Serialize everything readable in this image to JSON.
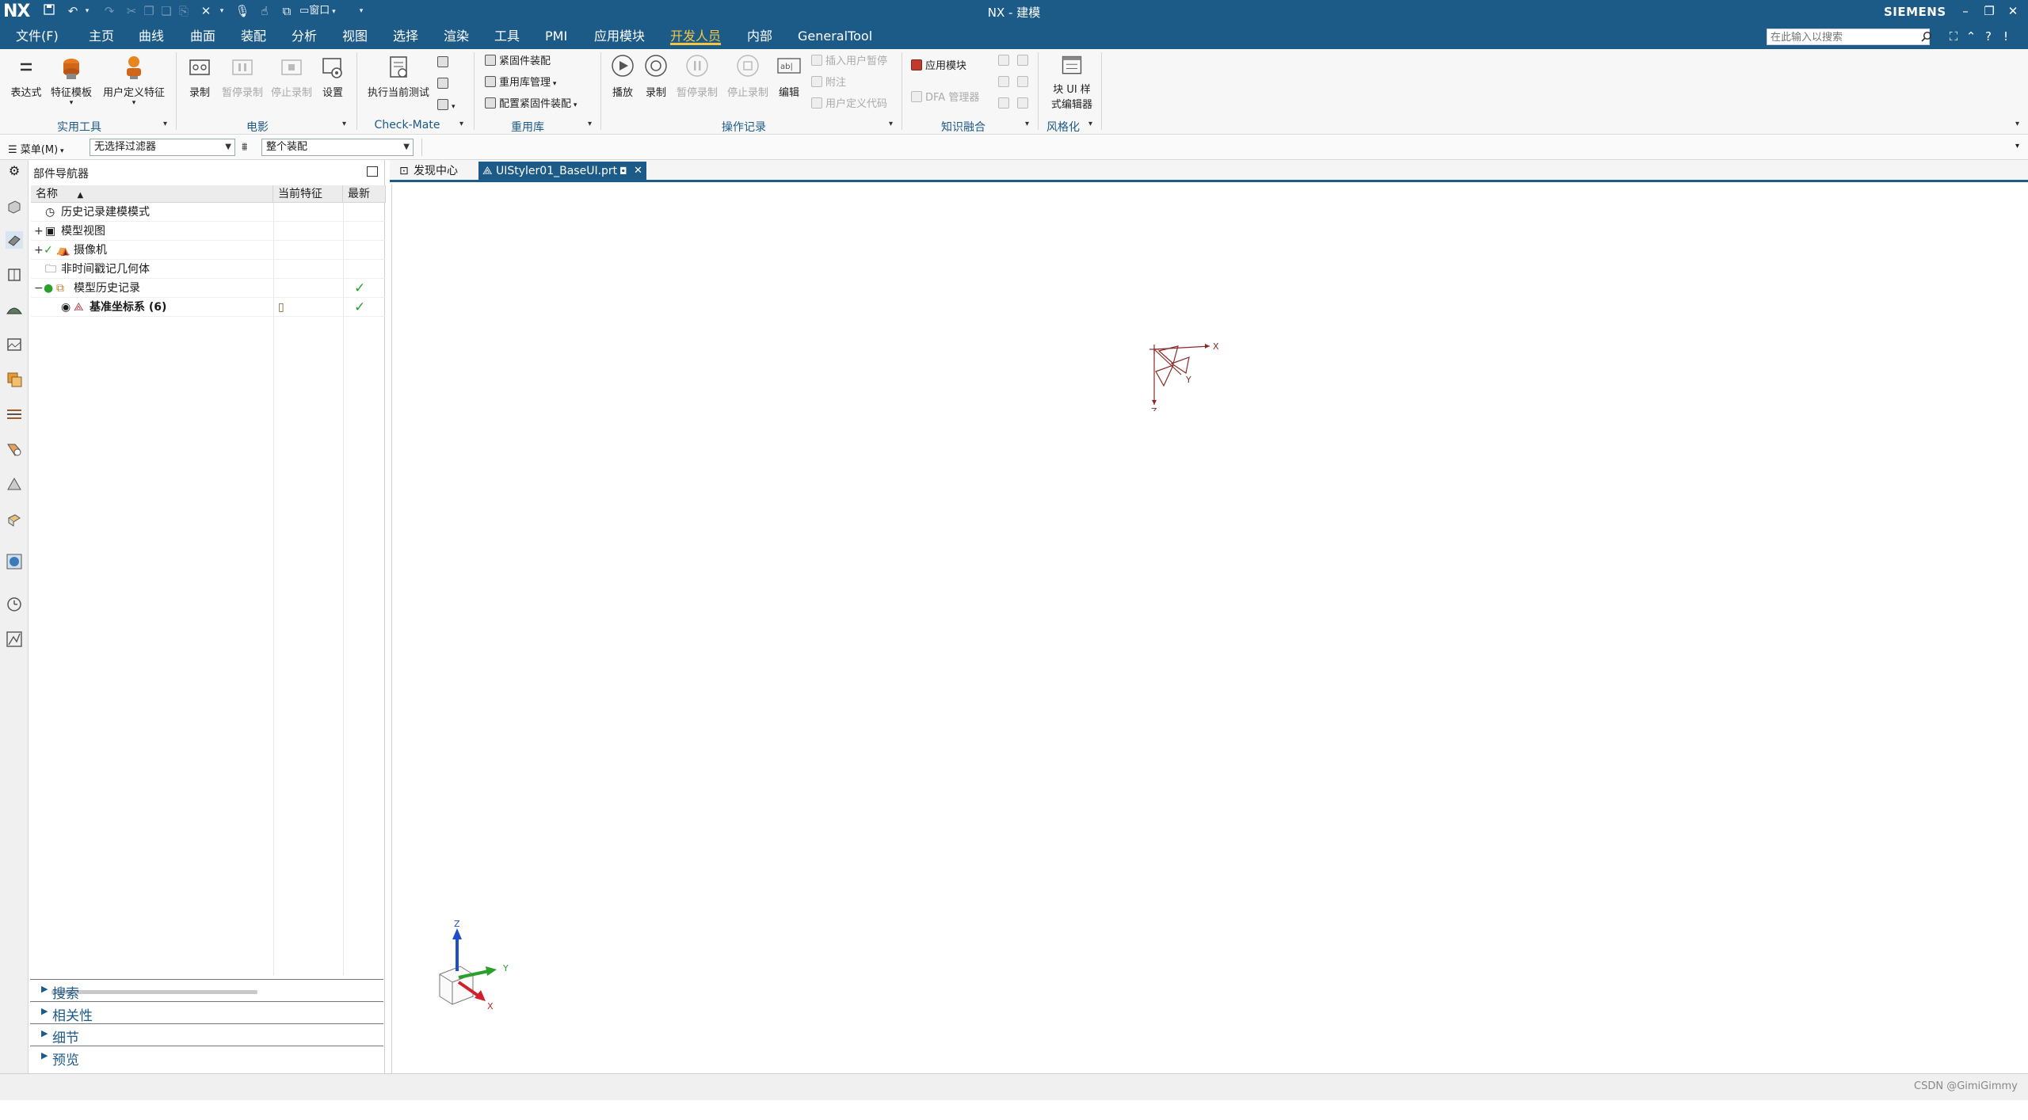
{
  "titlebar": {
    "logo": "NX",
    "title": "NX - 建模",
    "brand": "SIEMENS",
    "quick_access": [
      "save-icon",
      "undo-icon",
      "redo-icon",
      "cut-icon",
      "copy-icon",
      "paste-icon",
      "delete-icon",
      "microphone-icon",
      "touch-mode-icon",
      "switch-window-icon"
    ],
    "window_menu_label": "窗口"
  },
  "menubar": {
    "items": [
      {
        "label": "文件(F)"
      },
      {
        "label": "主页"
      },
      {
        "label": "曲线"
      },
      {
        "label": "曲面"
      },
      {
        "label": "装配"
      },
      {
        "label": "分析"
      },
      {
        "label": "视图"
      },
      {
        "label": "选择"
      },
      {
        "label": "渲染"
      },
      {
        "label": "工具"
      },
      {
        "label": "PMI"
      },
      {
        "label": "应用模块"
      },
      {
        "label": "开发人员"
      },
      {
        "label": "内部"
      },
      {
        "label": "GeneralTool"
      }
    ],
    "active_index": 12,
    "search_placeholder": "在此输入以搜索"
  },
  "ribbon": {
    "groups": [
      {
        "label": "实用工具",
        "buttons": [
          "表达式",
          "特征模板",
          "用户定义特征"
        ]
      },
      {
        "label": "电影",
        "buttons": [
          "录制",
          "暂停录制",
          "停止录制",
          "设置"
        ]
      },
      {
        "label": "Check-Mate",
        "buttons": [
          "执行当前测试"
        ]
      },
      {
        "label": "重用库",
        "buttons": [
          "紧固件装配",
          "重用库管理",
          "配置紧固件装配"
        ]
      },
      {
        "label": "操作记录",
        "buttons": [
          "播放",
          "录制",
          "暂停录制",
          "停止录制",
          "编辑",
          "插入用户暂停",
          "附注",
          "用户定义代码"
        ]
      },
      {
        "label": "知识融合",
        "buttons": [
          "应用模块",
          "DFA 管理器"
        ]
      },
      {
        "label": "风格化",
        "buttons": [
          "块 UI 样",
          "式编辑器"
        ]
      }
    ]
  },
  "selection_bar": {
    "menu_label": "菜单(M)",
    "filter_value": "无选择过滤器",
    "scope_value": "整个装配"
  },
  "navigator": {
    "title": "部件导航器",
    "columns": [
      "名称",
      "当前特征",
      "最新"
    ],
    "rows": [
      {
        "name": "历史记录建模模式",
        "icon": "clock-icon",
        "expander": "",
        "current": "",
        "latest": ""
      },
      {
        "name": "模型视图",
        "icon": "model-views-icon",
        "expander": "+",
        "current": "",
        "latest": ""
      },
      {
        "name": "摄像机",
        "icon": "camera-icon",
        "expander": "+",
        "current": "",
        "latest": ""
      },
      {
        "name": "非时间戳记几何体",
        "icon": "folder-icon",
        "expander": "",
        "current": "",
        "latest": ""
      },
      {
        "name": "模型历史记录",
        "icon": "history-icon",
        "expander": "−",
        "current": "",
        "latest": "✓"
      },
      {
        "name": "基准坐标系 (6)",
        "icon": "datum-csys-icon",
        "expander": "",
        "current": "▯",
        "latest": "✓"
      }
    ],
    "panels": [
      "搜索",
      "相关性",
      "细节",
      "预览"
    ]
  },
  "document_tabs": [
    {
      "label": "发现中心",
      "active": false
    },
    {
      "label": "UIStyler01_BaseUI.prt",
      "active": true
    }
  ],
  "graphics": {
    "datum_axes": [
      "X",
      "Y",
      "Z"
    ],
    "triad_axes": [
      "Z",
      "Y",
      "X"
    ],
    "colors": {
      "x": "#d0202c",
      "y": "#2aa02a",
      "z": "#1f4fc8",
      "datum": "#8b2a2a"
    }
  },
  "watermark": "CSDN @GimiGimmy",
  "colors": {
    "accent": "#1c5a87",
    "active_tab": "#f5c542",
    "check": "#2aa02a"
  }
}
